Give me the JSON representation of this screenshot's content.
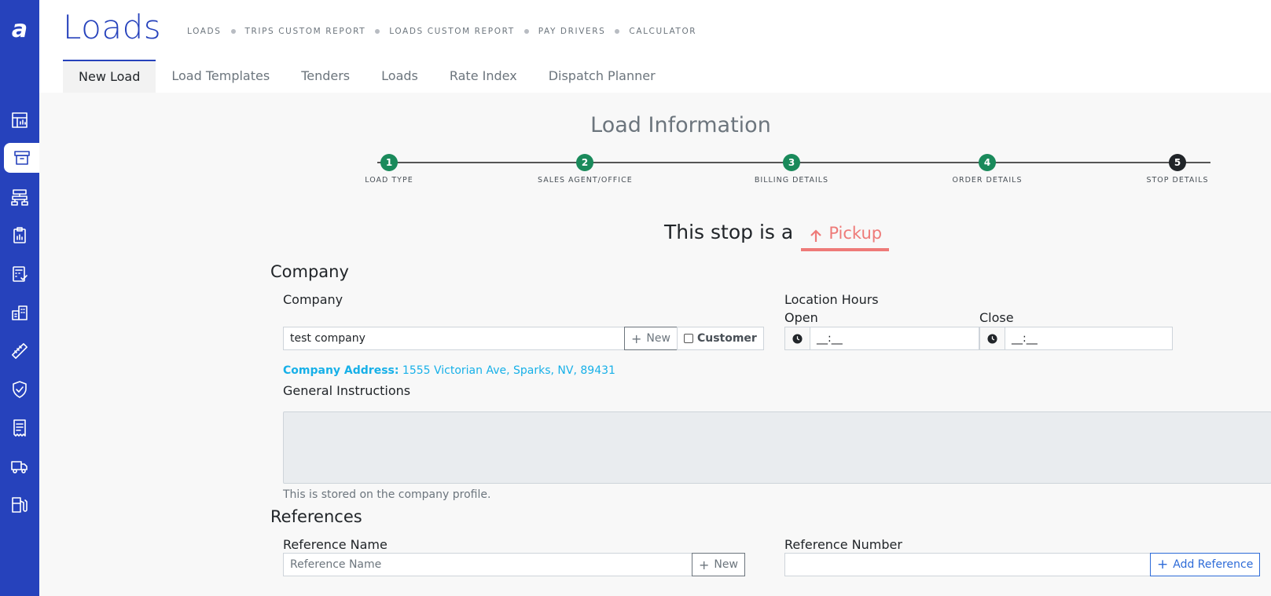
{
  "app": {
    "logo": "a"
  },
  "sidebar": {
    "items": [
      {
        "icon": "dashboard-chart-icon"
      },
      {
        "icon": "archive-box-icon",
        "active": true
      },
      {
        "icon": "org-chart-icon"
      },
      {
        "icon": "clipboard-icon"
      },
      {
        "icon": "calculator-check-icon"
      },
      {
        "icon": "buildings-icon"
      },
      {
        "icon": "ruler-icon"
      },
      {
        "icon": "shield-check-icon"
      },
      {
        "icon": "receipt-icon"
      },
      {
        "icon": "truck-icon"
      },
      {
        "icon": "fuel-pump-icon"
      }
    ]
  },
  "header": {
    "title": "Loads",
    "breadcrumbs": [
      "LOADS",
      "TRIPS CUSTOM REPORT",
      "LOADS CUSTOM REPORT",
      "PAY DRIVERS",
      "CALCULATOR"
    ],
    "tabs": [
      "New Load",
      "Load Templates",
      "Tenders",
      "Loads",
      "Rate Index",
      "Dispatch Planner"
    ],
    "active_tab": "New Load"
  },
  "main": {
    "heading": "Load Information",
    "steps": [
      {
        "number": "1",
        "label": "LOAD TYPE",
        "status": "complete"
      },
      {
        "number": "2",
        "label": "SALES AGENT/OFFICE",
        "status": "complete"
      },
      {
        "number": "3",
        "label": "BILLING DETAILS",
        "status": "complete"
      },
      {
        "number": "4",
        "label": "ORDER DETAILS",
        "status": "complete"
      },
      {
        "number": "5",
        "label": "STOP DETAILS",
        "status": "current"
      }
    ],
    "stop_prefix": "This stop is a",
    "stop_type": "Pickup",
    "colors": {
      "accent": "#2642bc",
      "step_complete": "#1a8a5b",
      "pickup": "#ee7a78",
      "address": "#17b0e8"
    },
    "company_section": {
      "heading": "Company",
      "company_label": "Company",
      "company_value": "test company",
      "new_button": "New",
      "customer_checkbox_label": "Customer",
      "customer_checked": false,
      "address_label": "Company Address:",
      "address_value": "1555 Victorian Ave, Sparks, NV, 89431",
      "location_hours_label": "Location Hours",
      "open_label": "Open",
      "open_value": "__:__",
      "close_label": "Close",
      "close_value": "__:__",
      "instructions_label": "General Instructions",
      "instructions_value": "",
      "instructions_help": "This is stored on the company profile."
    },
    "references_section": {
      "heading": "References",
      "name_label": "Reference Name",
      "name_placeholder": "Reference Name",
      "new_button": "New",
      "number_label": "Reference Number",
      "number_value": "",
      "add_button": "Add Reference"
    }
  }
}
